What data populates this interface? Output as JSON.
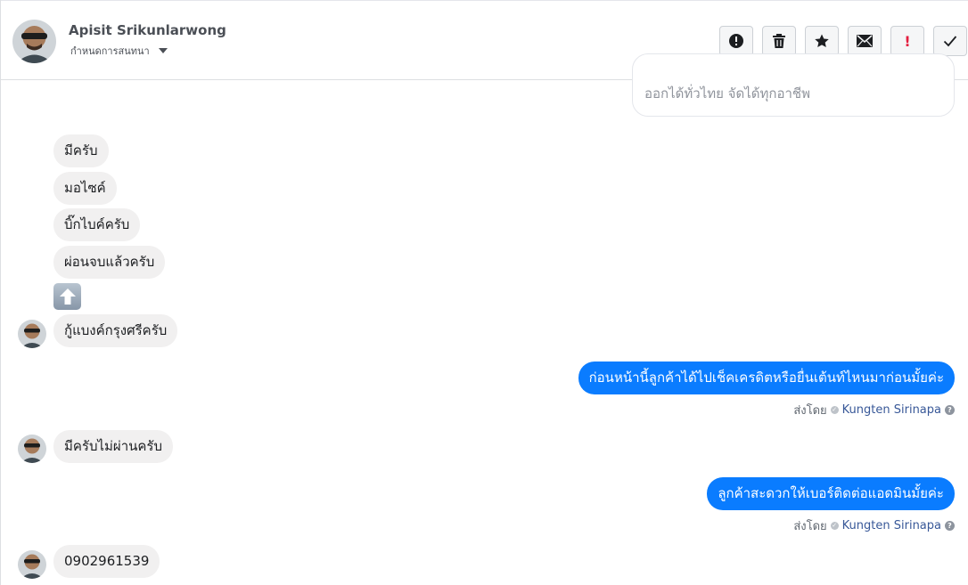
{
  "header": {
    "contact_name": "Apisit Srikunlarwong",
    "subtitle": "กำหนดการสนทนา",
    "actions": [
      {
        "name": "report-icon"
      },
      {
        "name": "trash-icon"
      },
      {
        "name": "star-icon"
      },
      {
        "name": "envelope-icon"
      },
      {
        "name": "exclamation-icon",
        "text": "!"
      },
      {
        "name": "check-icon"
      }
    ]
  },
  "conversation": {
    "quoted_preview": "ออกได้ทั่วไทย จัดได้ทุกอาชีพ",
    "incoming": [
      "มีครับ",
      "มอไซค์",
      "บิ๊กไบค์ครับ",
      "ผ่อนจบแล้วครับ",
      "กู้แบงค์กรุงศรีครับ",
      "มีครับไม่ผ่านครับ",
      "0902961539"
    ],
    "emoji": "up-arrow-emoji",
    "outgoing": [
      "ก่อนหน้านี้ลูกค้าได้ไปเช็คเครดิตหรือยื่นเต้นท์ไหนมาก่อนมั้ยค่ะ",
      "ลูกค้าสะดวกให้เบอร์ติดต่อแอดมินมั้ยค่ะ"
    ],
    "sent_by_label": "ส่งโดย",
    "sent_by_name": "Kungten Sirinapa",
    "help_mark": "?"
  },
  "colors": {
    "outgoing_bubble": "#0a7cff",
    "incoming_bubble": "#f1f0f0",
    "alert_red": "#e41e3f"
  }
}
